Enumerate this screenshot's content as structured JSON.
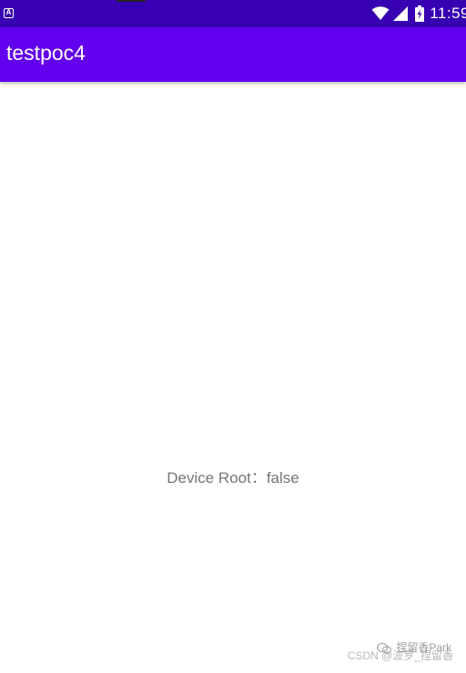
{
  "status_bar": {
    "time": "11:59",
    "app_icon_letter": "A",
    "background": "#3700b3"
  },
  "app_bar": {
    "title": "testpoc4",
    "background": "#6200ee"
  },
  "main": {
    "root_status": "Device Root：false"
  },
  "watermark": {
    "csdn_text": "CSDN @波罗_捏留香",
    "overlay_text": "捏留香Park"
  }
}
